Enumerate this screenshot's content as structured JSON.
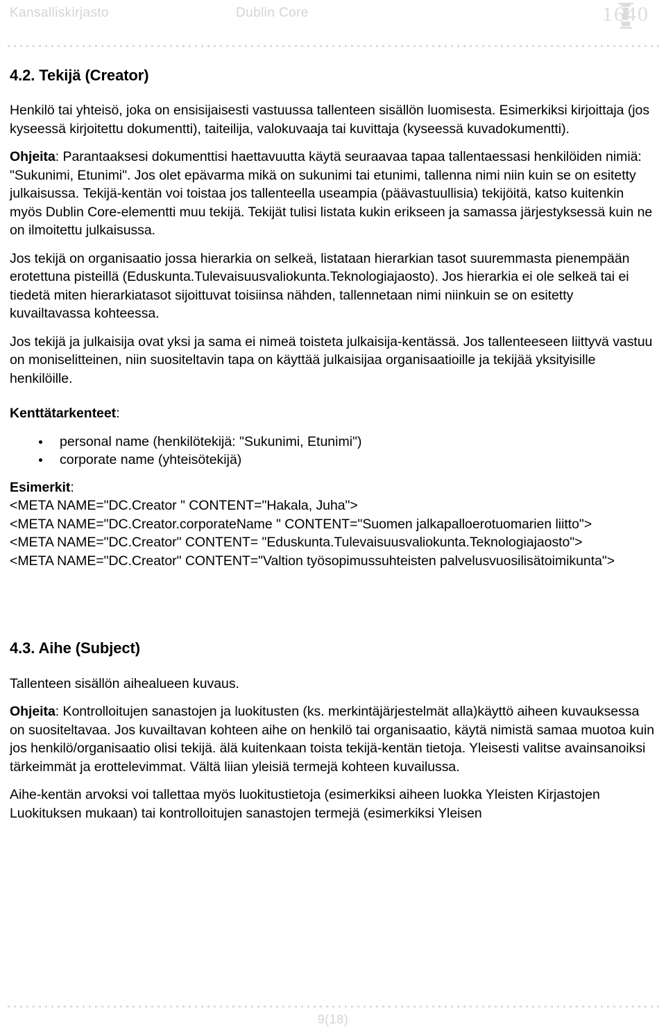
{
  "header": {
    "organization": "Kansalliskirjasto",
    "document_title": "Dublin Core",
    "logo_year": "1640",
    "logo_icon": "pillar-emblem-icon"
  },
  "sections": [
    {
      "heading": "4.2. Tekijä (Creator)",
      "definition": "Henkilö tai yhteisö, joka on ensisijaisesti vastuussa tallenteen sisällön luomisesta. Esimerkiksi kirjoittaja (jos kyseessä kirjoitettu dokumentti), taiteilija, valokuvaaja tai kuvittaja (kyseessä kuvadokumentti).",
      "guidance_label": "Ohjeita",
      "guidance_sep": ": ",
      "guidance_paragraphs": [
        "Parantaaksesi dokumenttisi haettavuutta käytä seuraavaa tapaa tallentaessasi henkilöiden nimiä: \"Sukunimi, Etunimi\". Jos olet epävarma mikä on sukunimi tai etunimi, tallenna nimi niin kuin se on esitetty julkaisussa. Tekijä-kentän voi toistaa jos tallenteella useampia (päävastuullisia) tekijöitä, katso kuitenkin myös Dublin Core-elementti muu tekijä. Tekijät tulisi listata kukin erikseen ja samassa järjestyksessä kuin ne on ilmoitettu julkaisussa.",
        "Jos tekijä on organisaatio jossa hierarkia on selkeä, listataan hierarkian tasot suuremmasta pienempään erotettuna pisteillä (Eduskunta.Tulevaisuusvaliokunta.Teknologiajaosto). Jos hierarkia ei ole selkeä tai ei tiedetä miten hierarkiatasot sijoittuvat toisiinsa nähden, tallennetaan nimi niinkuin se on esitetty kuvailtavassa kohteessa.",
        "Jos tekijä ja julkaisija ovat yksi ja sama ei nimeä toisteta julkaisija-kentässä. Jos tallenteeseen liittyvä vastuu on moniselitteinen, niin suositeltavin tapa on käyttää julkaisijaa organisaatioille ja tekijää yksityisille henkilöille."
      ],
      "refinements_label": "Kenttätarkenteet",
      "refinements_sep": ":",
      "refinements": [
        "personal name (henkilötekijä: \"Sukunimi, Etunimi\")",
        "corporate name (yhteisötekijä)"
      ],
      "examples_label": "Esimerkit",
      "examples_sep": ":",
      "examples": [
        "<META NAME=\"DC.Creator \" CONTENT=\"Hakala, Juha\">",
        "<META NAME=\"DC.Creator.corporateName \" CONTENT=\"Suomen jalkapalloerotuomarien liitto\">",
        "<META NAME=\"DC.Creator\" CONTENT= \"Eduskunta.Tulevaisuusvaliokunta.Teknologiajaosto\">",
        "<META NAME=\"DC.Creator\" CONTENT=\"Valtion työsopimussuhteisten palvelusvuosilisätoimikunta\">"
      ]
    },
    {
      "heading": "4.3. Aihe (Subject)",
      "definition": "Tallenteen sisällön aihealueen kuvaus.",
      "guidance_label": "Ohjeita",
      "guidance_sep": ":  ",
      "guidance_paragraphs": [
        "Kontrolloitujen sanastojen ja luokitusten (ks. merkintäjärjestelmät alla)käyttö aiheen kuvauksessa on suositeltavaa. Jos kuvailtavan kohteen aihe on henkilö tai organisaatio, käytä nimistä samaa muotoa kuin jos henkilö/organisaatio olisi tekijä. älä kuitenkaan toista tekijä-kentän tietoja. Yleisesti valitse avainsanoiksi tärkeimmät ja erottelevimmat. Vältä liian yleisiä termejä kohteen kuvailussa.",
        "Aihe-kentän arvoksi voi tallettaa myös luokitustietoja (esimerkiksi aiheen luokka Yleisten Kirjastojen Luokituksen mukaan) tai kontrolloitujen sanastojen termejä (esimerkiksi Yleisen"
      ]
    }
  ],
  "footer": {
    "page_number": "9(18)"
  },
  "colors": {
    "header_gray": "#d4d4d4",
    "text_black": "#000000",
    "dot_gray": "#d9d9d9",
    "page_background": "#ffffff"
  }
}
